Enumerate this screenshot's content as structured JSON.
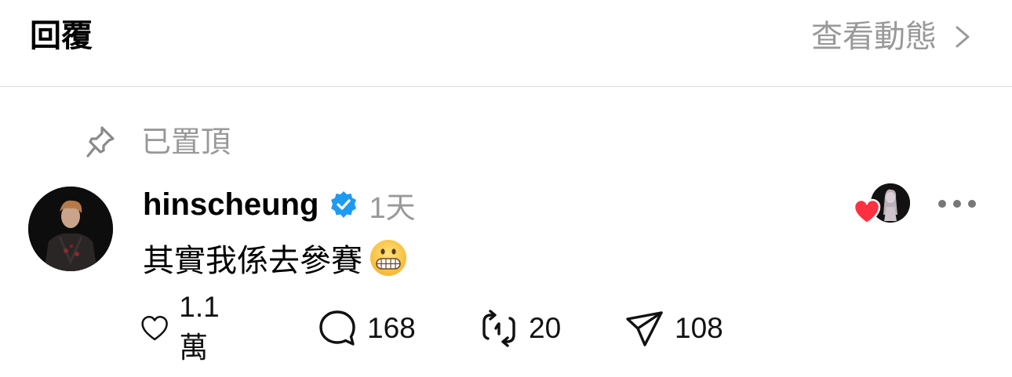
{
  "header": {
    "title": "回覆",
    "view_activity": "查看動態"
  },
  "pinned": {
    "label": "已置頂"
  },
  "post": {
    "username": "hinscheung",
    "time": "1天",
    "text": "其實我係去參賽",
    "emoji": "grimacing-face"
  },
  "actions": {
    "likes": "1.1萬",
    "comments": "168",
    "reposts": "20",
    "shares": "108"
  },
  "colors": {
    "verified": "#1d9bf0",
    "heart": "#ff3040",
    "muted": "#999999"
  }
}
